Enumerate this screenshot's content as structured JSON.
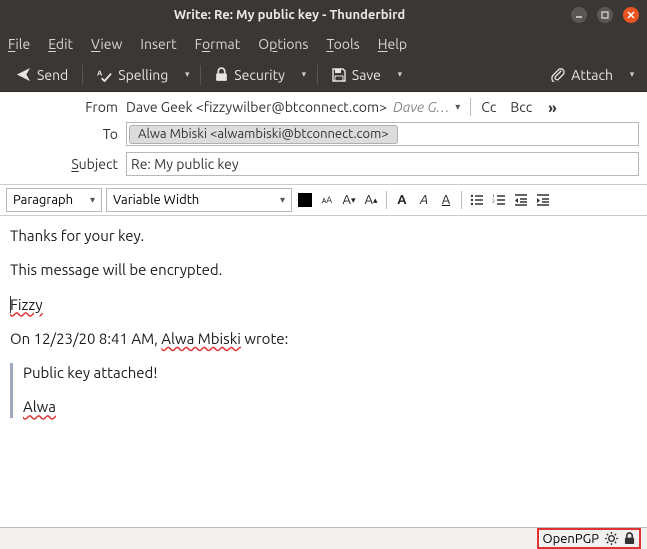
{
  "window": {
    "title": "Write: Re: My public key - Thunderbird"
  },
  "menus": {
    "file": "File",
    "edit": "Edit",
    "view": "View",
    "insert": "Insert",
    "format": "Format",
    "options": "Options",
    "tools": "Tools",
    "help": "Help"
  },
  "toolbar": {
    "send": "Send",
    "spelling": "Spelling",
    "security": "Security",
    "save": "Save",
    "attach": "Attach"
  },
  "headers": {
    "from_label": "From",
    "from_value": "Dave Geek <fizzywilber@btconnect.com>",
    "from_extra": "Dave G…",
    "cc": "Cc",
    "bcc": "Bcc",
    "to_label": "To",
    "to_value": "Alwa Mbiski <alwambiski@btconnect.com>",
    "subject_label": "Subject",
    "subject_value": "Re: My public key"
  },
  "format": {
    "paragraph": "Paragraph",
    "font": "Variable Width"
  },
  "body": {
    "p1": "Thanks for your key.",
    "p2": "This message will be encrypted.",
    "sig": "Fizzy",
    "quote_intro_pre": "On 12/23/20 8:41 AM, ",
    "quote_intro_name": "Alwa Mbiski",
    "quote_intro_post": " wrote:",
    "q1": "Public key attached!",
    "q2": "Alwa"
  },
  "status": {
    "label": "OpenPGP"
  }
}
